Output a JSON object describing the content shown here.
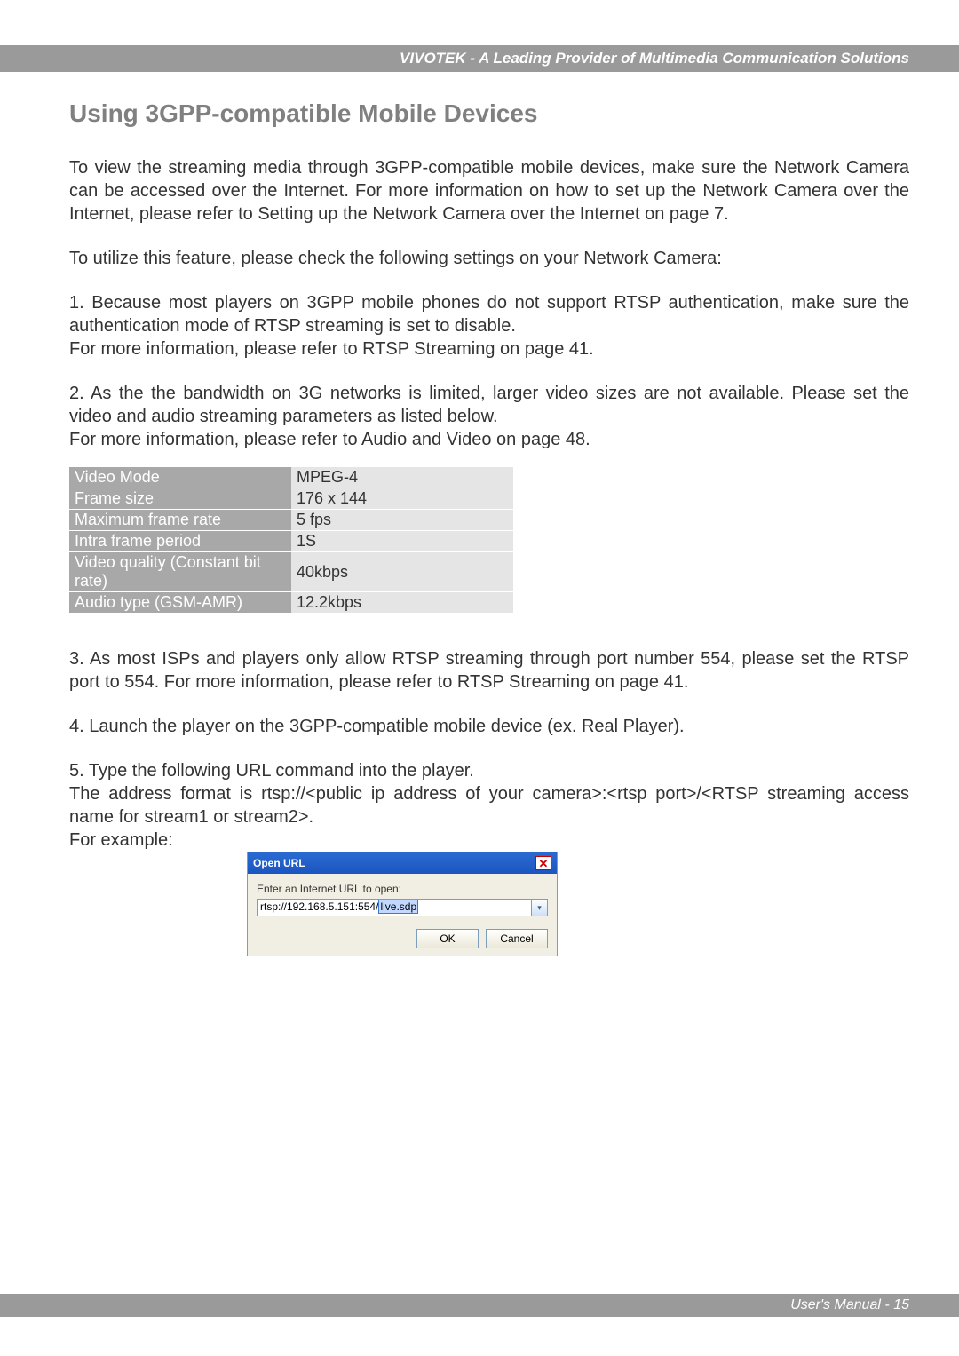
{
  "header": "VIVOTEK - A Leading Provider of Multimedia Communication Solutions",
  "title": "Using 3GPP-compatible Mobile Devices",
  "para1": "To view the streaming media through 3GPP-compatible mobile devices, make sure the Network Camera can be accessed over the Internet. For more information on how to set up the Network Camera over the Internet, please refer to Setting up the Network Camera over the Internet on page 7.",
  "para2": "To utilize this feature, please check the following settings on your Network Camera:",
  "item1": "1. Because most players on 3GPP mobile phones do not support RTSP authentication, make sure the authentication mode of RTSP streaming is set to disable.\n    For more information, please refer to RTSP Streaming on page 41.",
  "item2": "2. As the the bandwidth on 3G networks is limited, larger video sizes are not available. Please set the video and audio streaming parameters as listed below.\n    For more information, please refer to Audio and Video on page 48.",
  "settings": [
    {
      "label": "Video Mode",
      "value": "MPEG-4"
    },
    {
      "label": "Frame size",
      "value": "176 x 144"
    },
    {
      "label": "Maximum frame rate",
      "value": "5 fps"
    },
    {
      "label": "Intra frame period",
      "value": "1S"
    },
    {
      "label": "Video quality (Constant bit rate)",
      "value": "40kbps"
    },
    {
      "label": "Audio type (GSM-AMR)",
      "value": "12.2kbps"
    }
  ],
  "item3": "3. As most ISPs and players only allow RTSP streaming through port number 554, please set the RTSP port to 554. For more information, please refer to RTSP Streaming on page 41.",
  "item4": "4. Launch the player on the 3GPP-compatible mobile device (ex. Real Player).",
  "item5": "5. Type the following URL command into the player.\n    The address format is rtsp://<public ip address of your camera>:<rtsp port>/<RTSP streaming access name for stream1 or stream2>.\n    For example:",
  "dialog": {
    "title": "Open URL",
    "label": "Enter an Internet URL to open:",
    "url_prefix": "rtsp://192.168.5.151:554/",
    "url_highlight": "live.sdp",
    "ok": "OK",
    "cancel": "Cancel"
  },
  "footer": "User's Manual - 15"
}
